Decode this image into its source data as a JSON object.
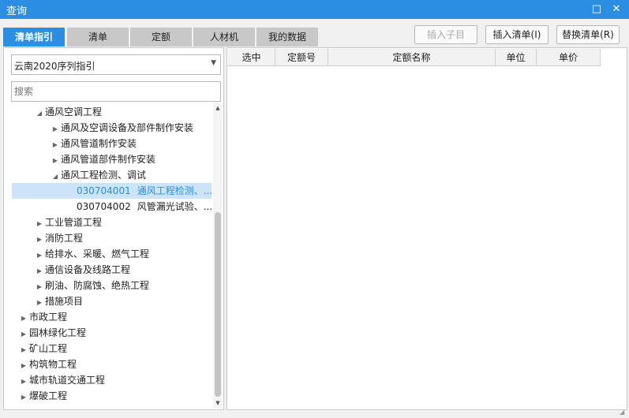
{
  "window": {
    "title": "查询"
  },
  "tabs": [
    {
      "label": "清单指引",
      "active": true
    },
    {
      "label": "清单",
      "active": false
    },
    {
      "label": "定额",
      "active": false
    },
    {
      "label": "人材机",
      "active": false
    },
    {
      "label": "我的数据",
      "active": false
    }
  ],
  "toolbar": {
    "insert_child": "插入子目",
    "insert_list": "插入清单(I)",
    "replace_list": "替换清单(R)"
  },
  "left_panel": {
    "combo_value": "云南2020序列指引",
    "search_placeholder": "搜索"
  },
  "tree": [
    {
      "label": "通风空调工程",
      "code": "",
      "level": 1,
      "toggle": "expanded"
    },
    {
      "label": "通风及空调设备及部件制作安装",
      "code": "",
      "level": 2,
      "toggle": "collapsed"
    },
    {
      "label": "通风管道制作安装",
      "code": "",
      "level": 2,
      "toggle": "collapsed"
    },
    {
      "label": "通风管道部件制作安装",
      "code": "",
      "level": 2,
      "toggle": "collapsed"
    },
    {
      "label": "通风工程检测、调试",
      "code": "",
      "level": 2,
      "toggle": "expanded"
    },
    {
      "label": "通风工程检测、...",
      "code": "030704001",
      "level": 3,
      "toggle": "none",
      "selected": true
    },
    {
      "label": "风管漏光试验、...",
      "code": "030704002",
      "level": 3,
      "toggle": "none"
    },
    {
      "label": "工业管道工程",
      "code": "",
      "level": 1,
      "toggle": "collapsed"
    },
    {
      "label": "消防工程",
      "code": "",
      "level": 1,
      "toggle": "collapsed"
    },
    {
      "label": "给排水、采暖、燃气工程",
      "code": "",
      "level": 1,
      "toggle": "collapsed"
    },
    {
      "label": "通信设备及线路工程",
      "code": "",
      "level": 1,
      "toggle": "collapsed"
    },
    {
      "label": "刷油、防腐蚀、绝热工程",
      "code": "",
      "level": 1,
      "toggle": "collapsed"
    },
    {
      "label": "措施项目",
      "code": "",
      "level": 1,
      "toggle": "collapsed"
    },
    {
      "label": "市政工程",
      "code": "",
      "level": 0,
      "toggle": "collapsed"
    },
    {
      "label": "园林绿化工程",
      "code": "",
      "level": 0,
      "toggle": "collapsed"
    },
    {
      "label": "矿山工程",
      "code": "",
      "level": 0,
      "toggle": "collapsed"
    },
    {
      "label": "构筑物工程",
      "code": "",
      "level": 0,
      "toggle": "collapsed"
    },
    {
      "label": "城市轨道交通工程",
      "code": "",
      "level": 0,
      "toggle": "collapsed"
    },
    {
      "label": "爆破工程",
      "code": "",
      "level": 0,
      "toggle": "collapsed"
    }
  ],
  "table": {
    "columns": [
      "选中",
      "定额号",
      "定额名称",
      "单位",
      "单价"
    ],
    "rows": []
  },
  "colors": {
    "accent": "#2b8ee0",
    "selection_bg": "#cce4f7"
  },
  "icons": {
    "maximize": "maximize-icon",
    "close": "close-icon",
    "expanded": "triangle-down-icon",
    "collapsed": "triangle-right-icon"
  }
}
